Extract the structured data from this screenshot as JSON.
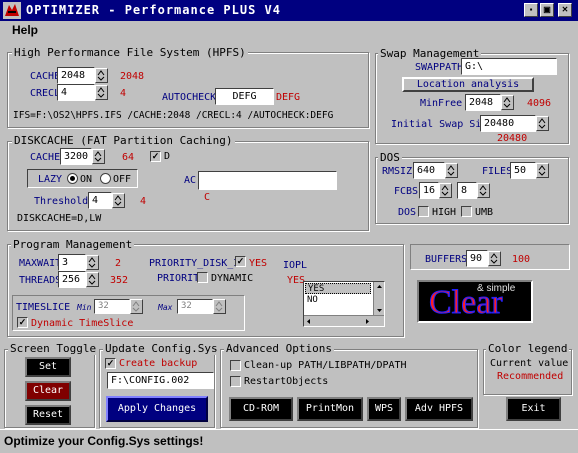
{
  "window": {
    "title": "OPTIMIZER - Performance PLUS V4",
    "menu_help": "Help"
  },
  "hpfs": {
    "group_title": "High Performance File System (HPFS)",
    "cache_label": "CACHE",
    "cache_value": "2048",
    "cache_current": "2048",
    "crecl_label": "CRECL",
    "crecl_value": "4",
    "crecl_current": "4",
    "autocheck_label": "AUTOCHECK",
    "autocheck_value": "DEFG",
    "autocheck_current": "DEFG",
    "ifs_line": "IFS=F:\\OS2\\HPFS.IFS /CACHE:2048 /CRECL:4 /AUTOCHECK:DEFG"
  },
  "swap": {
    "group_title": "Swap Management",
    "swappath_label": "SWAPPATH",
    "swappath_value": "G:\\",
    "location_button": "Location analysis",
    "minfree_label": "MinFree",
    "minfree_value": "2048",
    "minfree_current": "4096",
    "initial_label": "Initial Swap Size",
    "initial_value": "20480",
    "initial_current": "20480"
  },
  "diskcache": {
    "group_title": "DISKCACHE  (FAT Partition Caching)",
    "cache_label": "CACHE",
    "cache_value": "3200",
    "cache_current": "64",
    "d_label": "D",
    "d_checked": true,
    "lazy_label": "LAZY",
    "on_label": "ON",
    "off_label": "OFF",
    "lazy_on": true,
    "ac_label": "AC:",
    "ac_value": "",
    "ac_current": "C",
    "threshold_label": "Threshold",
    "threshold_value": "4",
    "threshold_current": "4",
    "summary": "DISKCACHE=D,LW"
  },
  "dos": {
    "group_title": "DOS",
    "rmsize_label": "RMSIZE",
    "rmsize_value": "640",
    "files_label": "FILES",
    "files_value": "50",
    "fcbs_label": "FCBS",
    "fcbs_value1": "16",
    "fcbs_value2": "8",
    "dos_label": "DOS",
    "high_label": "HIGH",
    "umb_label": "UMB"
  },
  "buffers": {
    "label": "BUFFERS",
    "value": "90",
    "current": "100"
  },
  "program": {
    "group_title": "Program Management",
    "maxwait_label": "MAXWAIT",
    "maxwait_value": "3",
    "maxwait_current": "2",
    "threads_label": "THREADS",
    "threads_value": "256",
    "threads_current": "352",
    "priority_disk_label": "PRIORITY_DISK_IO",
    "priority_disk_value": "YES",
    "priority_disk_checked": true,
    "iopl_label": "IOPL",
    "iopl_current": "YES",
    "priority_label": "PRIORITY",
    "dynamic_label": "DYNAMIC",
    "timeslice_label": "TIMESLICE",
    "min_label": "Min",
    "max_label": "Max",
    "min_value": "32",
    "max_value": "32",
    "dynamic_timeslice_label": "Dynamic TimeSlice",
    "iopl_options": [
      "YES",
      "NO"
    ]
  },
  "logo": {
    "main": "Clear",
    "sub": "& simple"
  },
  "screen_toggle": {
    "group_title": "Screen Toggle",
    "set": "Set",
    "clear": "Clear",
    "reset": "Reset"
  },
  "update": {
    "group_title": "Update Config.Sys",
    "create_backup": "Create backup",
    "backup_path": "F:\\CONFIG.002",
    "apply": "Apply Changes"
  },
  "advanced": {
    "group_title": "Advanced Options",
    "cleanup": "Clean-up PATH/LIBPATH/DPATH",
    "restart": "RestartObjects",
    "cdrom": "CD-ROM",
    "printmon": "PrintMon",
    "wps": "WPS",
    "advhpfs": "Adv HPFS"
  },
  "legend": {
    "group_title": "Color legend",
    "current": "Current value",
    "recommended": "Recommended"
  },
  "exit_label": "Exit",
  "status": "Optimize your Config.Sys settings!",
  "colors": {
    "titlebar": "#000080",
    "label": "#000080",
    "current": "#c00000",
    "panel": "#c0c0c0"
  }
}
